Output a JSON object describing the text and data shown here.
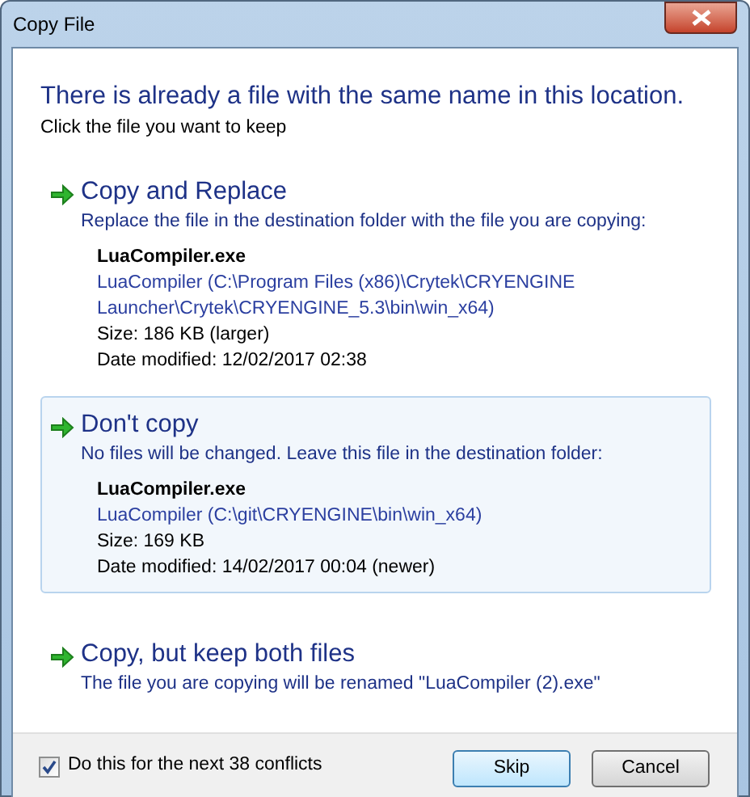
{
  "window": {
    "title": "Copy File"
  },
  "heading": "There is already a file with the same name in this location.",
  "instruction": "Click the file you want to keep",
  "options": [
    {
      "title": "Copy and Replace",
      "description": "Replace the file in the destination folder with the file you are copying:",
      "selected": false,
      "file": {
        "name": "LuaCompiler.exe",
        "path_lines": [
          "LuaCompiler (C:\\Program Files (x86)\\Crytek\\CRYENGINE",
          "Launcher\\Crytek\\CRYENGINE_5.3\\bin\\win_x64)"
        ],
        "size": "Size: 186 KB (larger)",
        "modified": "Date modified: 12/02/2017 02:38"
      }
    },
    {
      "title": "Don't copy",
      "description": "No files will be changed. Leave this file in the destination folder:",
      "selected": true,
      "file": {
        "name": "LuaCompiler.exe",
        "path_lines": [
          "LuaCompiler (C:\\git\\CRYENGINE\\bin\\win_x64)"
        ],
        "size": "Size: 169 KB",
        "modified": "Date modified: 14/02/2017 00:04 (newer)"
      }
    },
    {
      "title": "Copy, but keep both files",
      "description": "The file you are copying will be renamed \"LuaCompiler (2).exe\"",
      "selected": false
    }
  ],
  "footer": {
    "checkbox": {
      "label": "Do this for the next 38 conflicts",
      "checked": true
    },
    "buttons": [
      "Skip",
      "Cancel"
    ]
  }
}
